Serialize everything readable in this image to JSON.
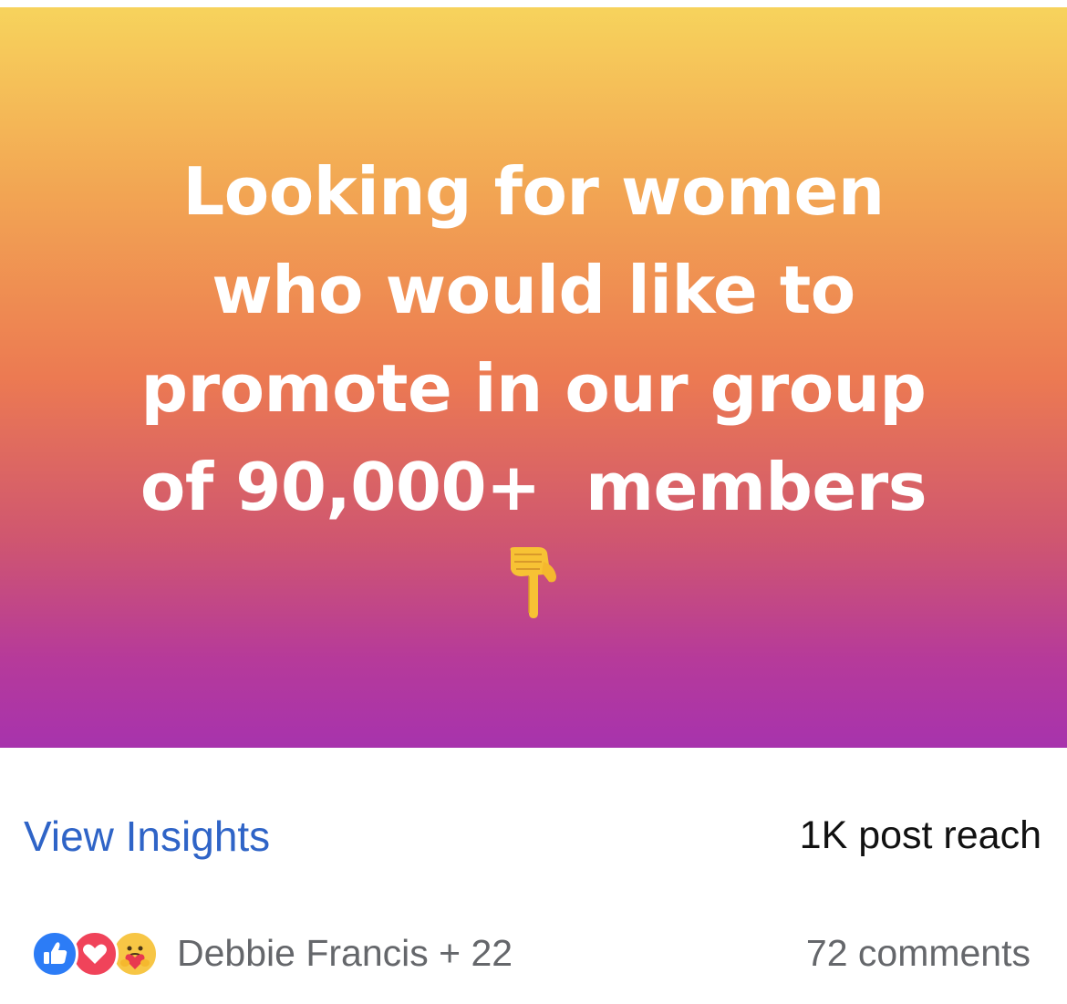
{
  "post": {
    "lines": [
      "Looking for women",
      "who would like to",
      "promote in our group",
      "of 90,000+  members"
    ],
    "emoji": "pointing-down-hand",
    "gradient_colors": [
      "#f7d35c",
      "#f2a553",
      "#ec7a52",
      "#cf5670",
      "#b63a9a",
      "#a733ad"
    ]
  },
  "insights": {
    "view_label": "View Insights",
    "reach_text": "1K post reach",
    "accent": "#2f64c7"
  },
  "reactions": {
    "icons": [
      "like-icon",
      "love-icon",
      "care-icon"
    ],
    "reactors_text": "Debbie Francis + 22",
    "comments_text": "72 comments"
  }
}
